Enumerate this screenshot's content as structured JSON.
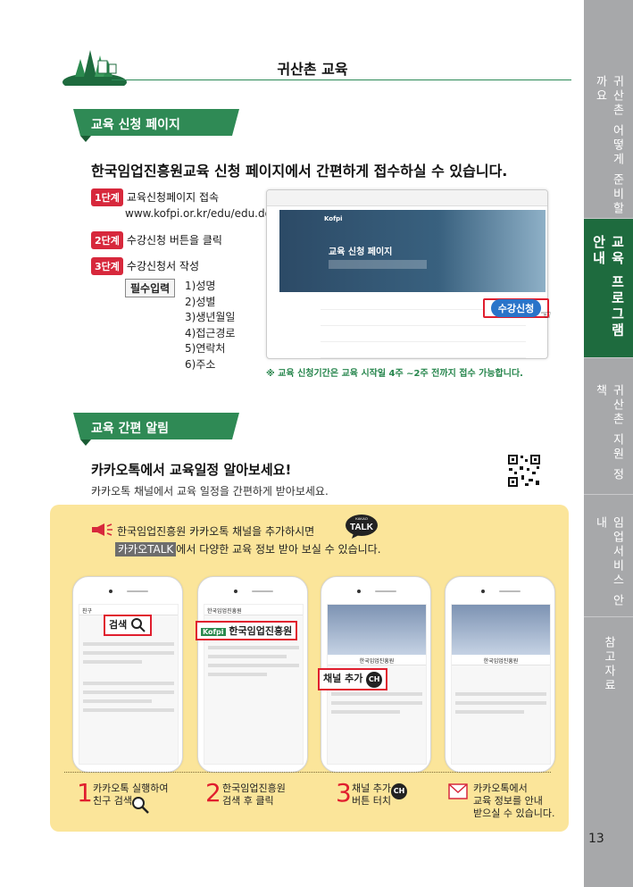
{
  "header": {
    "title": "귀산촌 교육"
  },
  "tabs": [
    {
      "label": "귀산촌 어떻게 준비할까요",
      "active": false
    },
    {
      "label": "교육 프로그램 안내",
      "active": true
    },
    {
      "label": "귀산촌 지원 정책",
      "active": false
    },
    {
      "label": "임업서비스 안내",
      "active": false
    },
    {
      "label": "참고자료",
      "active": false
    }
  ],
  "section1": {
    "heading": "교육 신청 페이지",
    "headline": "한국임업진흥원교육 신청 페이지에서 간편하게 접수하실 수 있습니다.",
    "steps": [
      {
        "badge": "1단계",
        "text": "교육신청페이지 접속"
      },
      {
        "badge": "2단계",
        "text": "수강신청 버튼을 클릭"
      },
      {
        "badge": "3단계",
        "text": "수강신청서 작성"
      }
    ],
    "url": "www.kofpi.or.kr/edu/edu.do",
    "required_label": "필수입력",
    "required_items": [
      "1)성명",
      "2)성별",
      "3)생년월일",
      "4)접근경로",
      "5)연락처",
      "6)주소"
    ],
    "browser": {
      "logo": "Kofpi",
      "hero_title": "교육 신청 페이지",
      "apply_button": "수강신청"
    },
    "note": "※ 교육 신청기간은 교육 시작일 4주 ~2주 전까지 접수 가능합니다."
  },
  "section2": {
    "heading": "교육 간편 알림",
    "headline": "카카오톡에서 교육일정 알아보세요!",
    "subline": "카카오톡 채널에서 교육 일정을 간편하게 받아보세요.",
    "box_line1": "한국임업진흥원 카카오톡 채널을 추가하시면",
    "talk_bubble_top": "KAKAO",
    "talk_bubble": "TALK",
    "box_badge": "카카오TALK",
    "box_line2": "에서 다양한 교육 정보 받아 보실 수 있습니다.",
    "phones": [
      {
        "top": "친구",
        "callout": "검색"
      },
      {
        "top": "한국임업진흥원",
        "callout": "한국임업진흥원"
      },
      {
        "top": "한국임업진흥원",
        "callout": "채널 추가"
      },
      {
        "top": "한국임업진흥원",
        "callout": ""
      }
    ],
    "ch_label": "CH",
    "captions": [
      {
        "num": "1",
        "line1": "카카오톡 실행하여",
        "line2": "친구 검색"
      },
      {
        "num": "2",
        "line1": "한국임업진흥원",
        "line2": "검색 후 클릭"
      },
      {
        "num": "3",
        "line1": "채널 추가",
        "line2": "버튼 터치"
      },
      {
        "num": "",
        "line1": "카카오톡에서",
        "line2": "교육 정보를 안내",
        "line3": "받으실 수 있습니다."
      }
    ]
  },
  "page_number": "13",
  "colors": {
    "brand_green": "#1e6b3e",
    "accent_red": "#d7283c",
    "box_yellow": "#fbe59a",
    "tab_gray": "#a7a8aa"
  }
}
